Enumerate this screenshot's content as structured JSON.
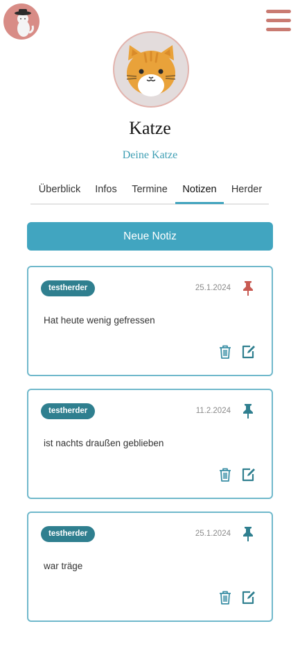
{
  "header": {
    "avatar_icon": "cat-with-hat-avatar",
    "menu_icon": "hamburger-menu-icon"
  },
  "profile": {
    "name": "Katze",
    "subtitle": "Deine Katze",
    "picture_icon": "orange-cat-icon"
  },
  "tabs": [
    {
      "label": "Überblick",
      "active": false
    },
    {
      "label": "Infos",
      "active": false
    },
    {
      "label": "Termine",
      "active": false
    },
    {
      "label": "Notizen",
      "active": true
    },
    {
      "label": "Herder",
      "active": false
    }
  ],
  "new_note_label": "Neue Notiz",
  "notes": [
    {
      "author": "testherder",
      "date": "25.1.2024",
      "text": "Hat heute wenig gefressen",
      "pinned": true
    },
    {
      "author": "testherder",
      "date": "11.2.2024",
      "text": "ist nachts draußen geblieben",
      "pinned": false
    },
    {
      "author": "testherder",
      "date": "25.1.2024",
      "text": "war träge",
      "pinned": false
    }
  ],
  "colors": {
    "accent": "#41a5c0",
    "badge": "#2f7f8f",
    "pin_active": "#c85a52",
    "pin_inactive": "#2f7f8f",
    "menu": "#c97b72"
  }
}
